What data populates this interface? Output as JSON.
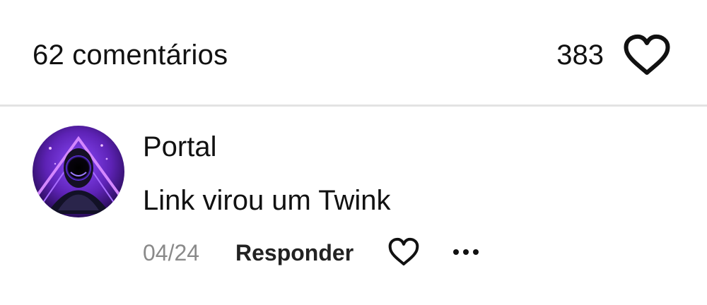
{
  "header": {
    "comment_count": "62 comentários",
    "like_total": "383",
    "heart_icon": "heart-outline-icon"
  },
  "comment": {
    "author": "Portal",
    "text": "Link virou um Twink",
    "date": "04/24",
    "reply_label": "Responder",
    "like_icon": "heart-outline-icon",
    "more_icon": "more-horizontal-icon",
    "avatar_colors": [
      "#2a0f63",
      "#7a31d6",
      "#b66cff",
      "#060312"
    ]
  }
}
